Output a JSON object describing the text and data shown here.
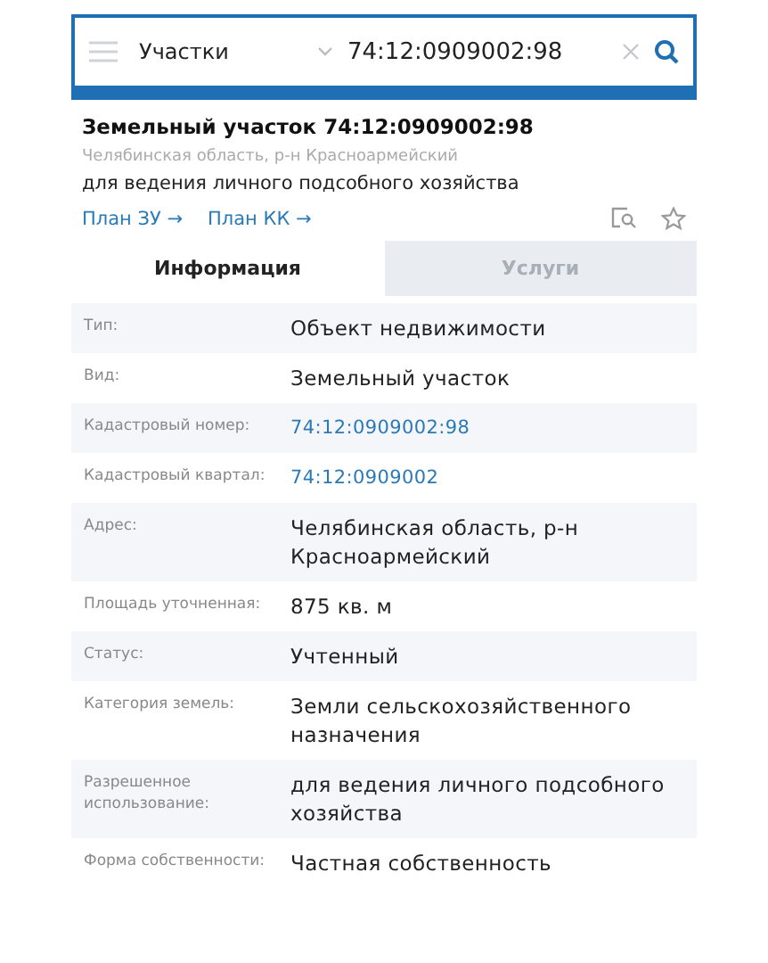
{
  "search_bar": {
    "category": "Участки",
    "query": "74:12:0909002:98"
  },
  "header": {
    "title": "Земельный участок 74:12:0909002:98",
    "region": "Челябинская область, р-н Красноармейский",
    "purpose": "для ведения личного подсобного хозяйства",
    "links": [
      "План ЗУ →",
      "План КК →"
    ]
  },
  "tabs": [
    {
      "label": "Информация",
      "selected": true
    },
    {
      "label": "Услуги",
      "selected": false
    }
  ],
  "rows": [
    {
      "label": "Тип:",
      "value": "Объект недвижимости",
      "kind": "text"
    },
    {
      "label": "Вид:",
      "value": "Земельный участок",
      "kind": "text"
    },
    {
      "label": "Кадастровый номер:",
      "value": "74:12:0909002:98",
      "kind": "link"
    },
    {
      "label": "Кадастровый квартал:",
      "value": "74:12:0909002",
      "kind": "link"
    },
    {
      "label": "Адрес:",
      "value": "Челябинская область, р-н Красноармейский",
      "kind": "text"
    },
    {
      "label": "Площадь уточненная:",
      "value": "875 кв. м",
      "kind": "text"
    },
    {
      "label": "Статус:",
      "value": "Учтенный",
      "kind": "text"
    },
    {
      "label": "Категория земель:",
      "value": "Земли сельскохозяйственного назначения",
      "kind": "text"
    },
    {
      "label": "Разрешенное использование:",
      "value": "для ведения личного подсобного хозяйства",
      "kind": "text"
    },
    {
      "label": "Форма собственности:",
      "value": "Частная собственность",
      "kind": "text"
    }
  ]
}
